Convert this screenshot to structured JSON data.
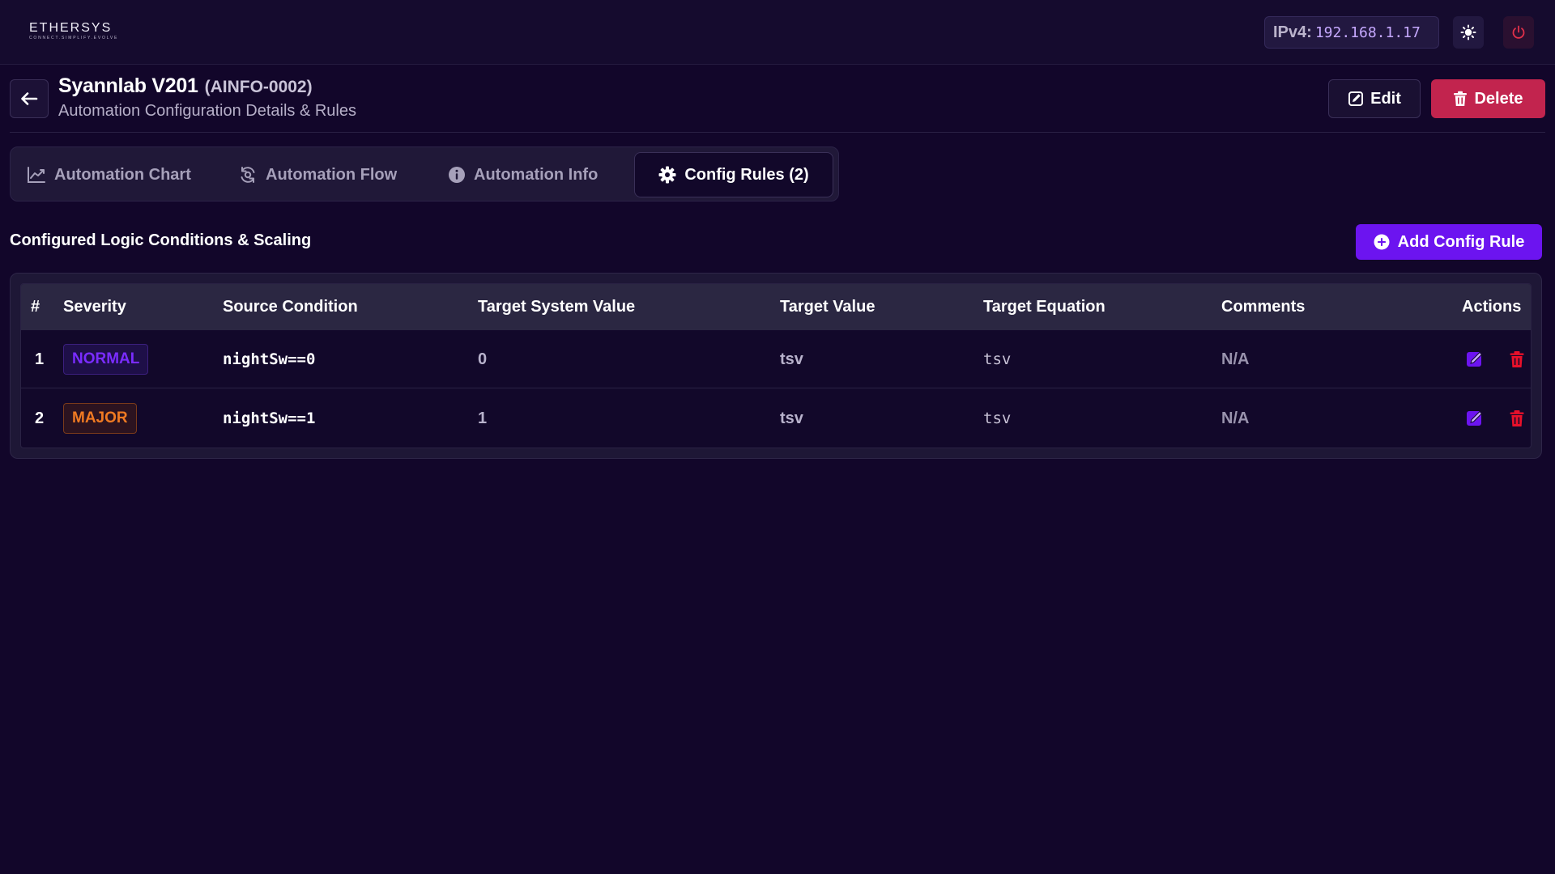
{
  "app": {
    "logo_text": "ETHERSYS",
    "logo_tagline": "CONNECT.SIMPLIFY.EVOLVE",
    "ip_label": "IPv4:",
    "ip_value": "192.168.1.17",
    "icons": {
      "theme": "sun-icon",
      "power": "power-icon"
    }
  },
  "header": {
    "title": "Syannlab V201",
    "code": "(AINFO-0002)",
    "subtitle": "Automation Configuration Details & Rules",
    "edit_label": "Edit",
    "delete_label": "Delete"
  },
  "tabs": [
    {
      "label": "Automation Chart",
      "icon": "chart-line-icon",
      "active": false
    },
    {
      "label": "Automation Flow",
      "icon": "flow-sync-icon",
      "active": false
    },
    {
      "label": "Automation Info",
      "icon": "info-icon",
      "active": false
    },
    {
      "label": "Config Rules (2)",
      "icon": "gear-icon",
      "active": true
    }
  ],
  "section": {
    "title": "Configured Logic Conditions & Scaling",
    "add_label": "Add Config Rule"
  },
  "table": {
    "columns": [
      "#",
      "Severity",
      "Source Condition",
      "Target System Value",
      "Target Value",
      "Target Equation",
      "Comments",
      "Actions"
    ],
    "rows": [
      {
        "num": "1",
        "severity": "NORMAL",
        "source_condition": "nightSw==0",
        "target_system_value": "0",
        "target_value": "tsv",
        "target_equation": "tsv",
        "comments": "N/A"
      },
      {
        "num": "2",
        "severity": "MAJOR",
        "source_condition": "nightSw==1",
        "target_system_value": "1",
        "target_value": "tsv",
        "target_equation": "tsv",
        "comments": "N/A"
      }
    ]
  },
  "colors": {
    "background": "#12062a",
    "accent": "#6c14f0",
    "danger": "#c2244e",
    "severity_normal": "#7a2cff",
    "severity_major": "#f07a22"
  }
}
